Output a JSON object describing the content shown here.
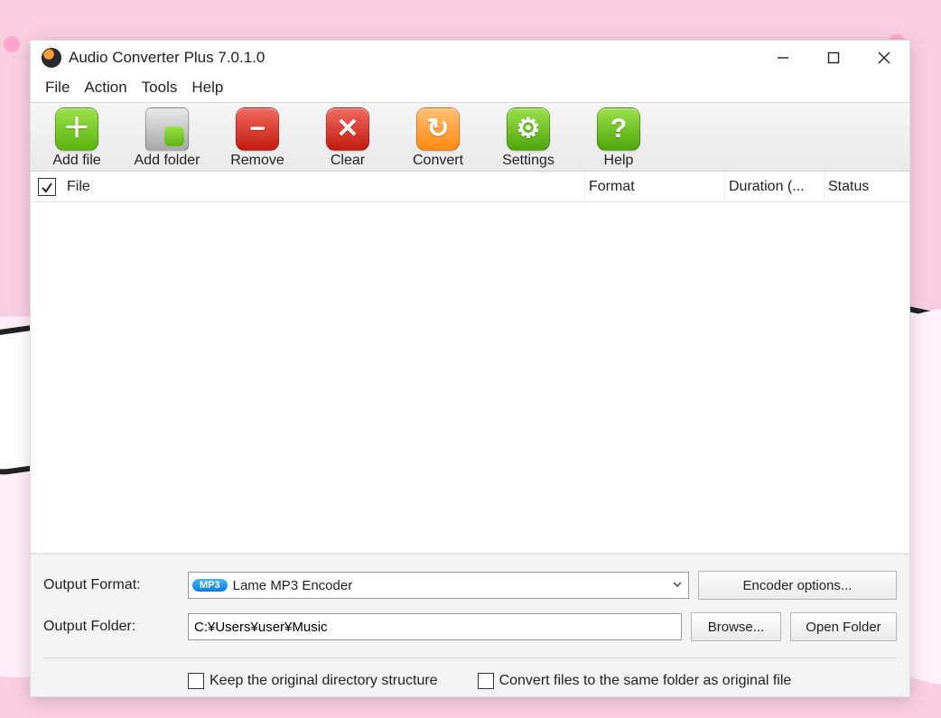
{
  "window": {
    "title": "Audio Converter Plus 7.0.1.0"
  },
  "menu": {
    "file": "File",
    "action": "Action",
    "tools": "Tools",
    "help": "Help"
  },
  "toolbar": {
    "add_file": "Add file",
    "add_folder": "Add folder",
    "remove": "Remove",
    "clear": "Clear",
    "convert": "Convert",
    "settings": "Settings",
    "help": "Help"
  },
  "columns": {
    "file": "File",
    "format": "Format",
    "duration": "Duration (...",
    "status": "Status"
  },
  "output": {
    "format_label": "Output Format:",
    "format_value": "Lame MP3 Encoder",
    "format_badge": "MP3",
    "encoder_options": "Encoder options...",
    "folder_label": "Output Folder:",
    "folder_value": "C:¥Users¥user¥Music",
    "browse": "Browse...",
    "open_folder": "Open Folder"
  },
  "options": {
    "keep_structure": "Keep the original directory structure",
    "same_folder": "Convert files to the same folder as original file"
  }
}
